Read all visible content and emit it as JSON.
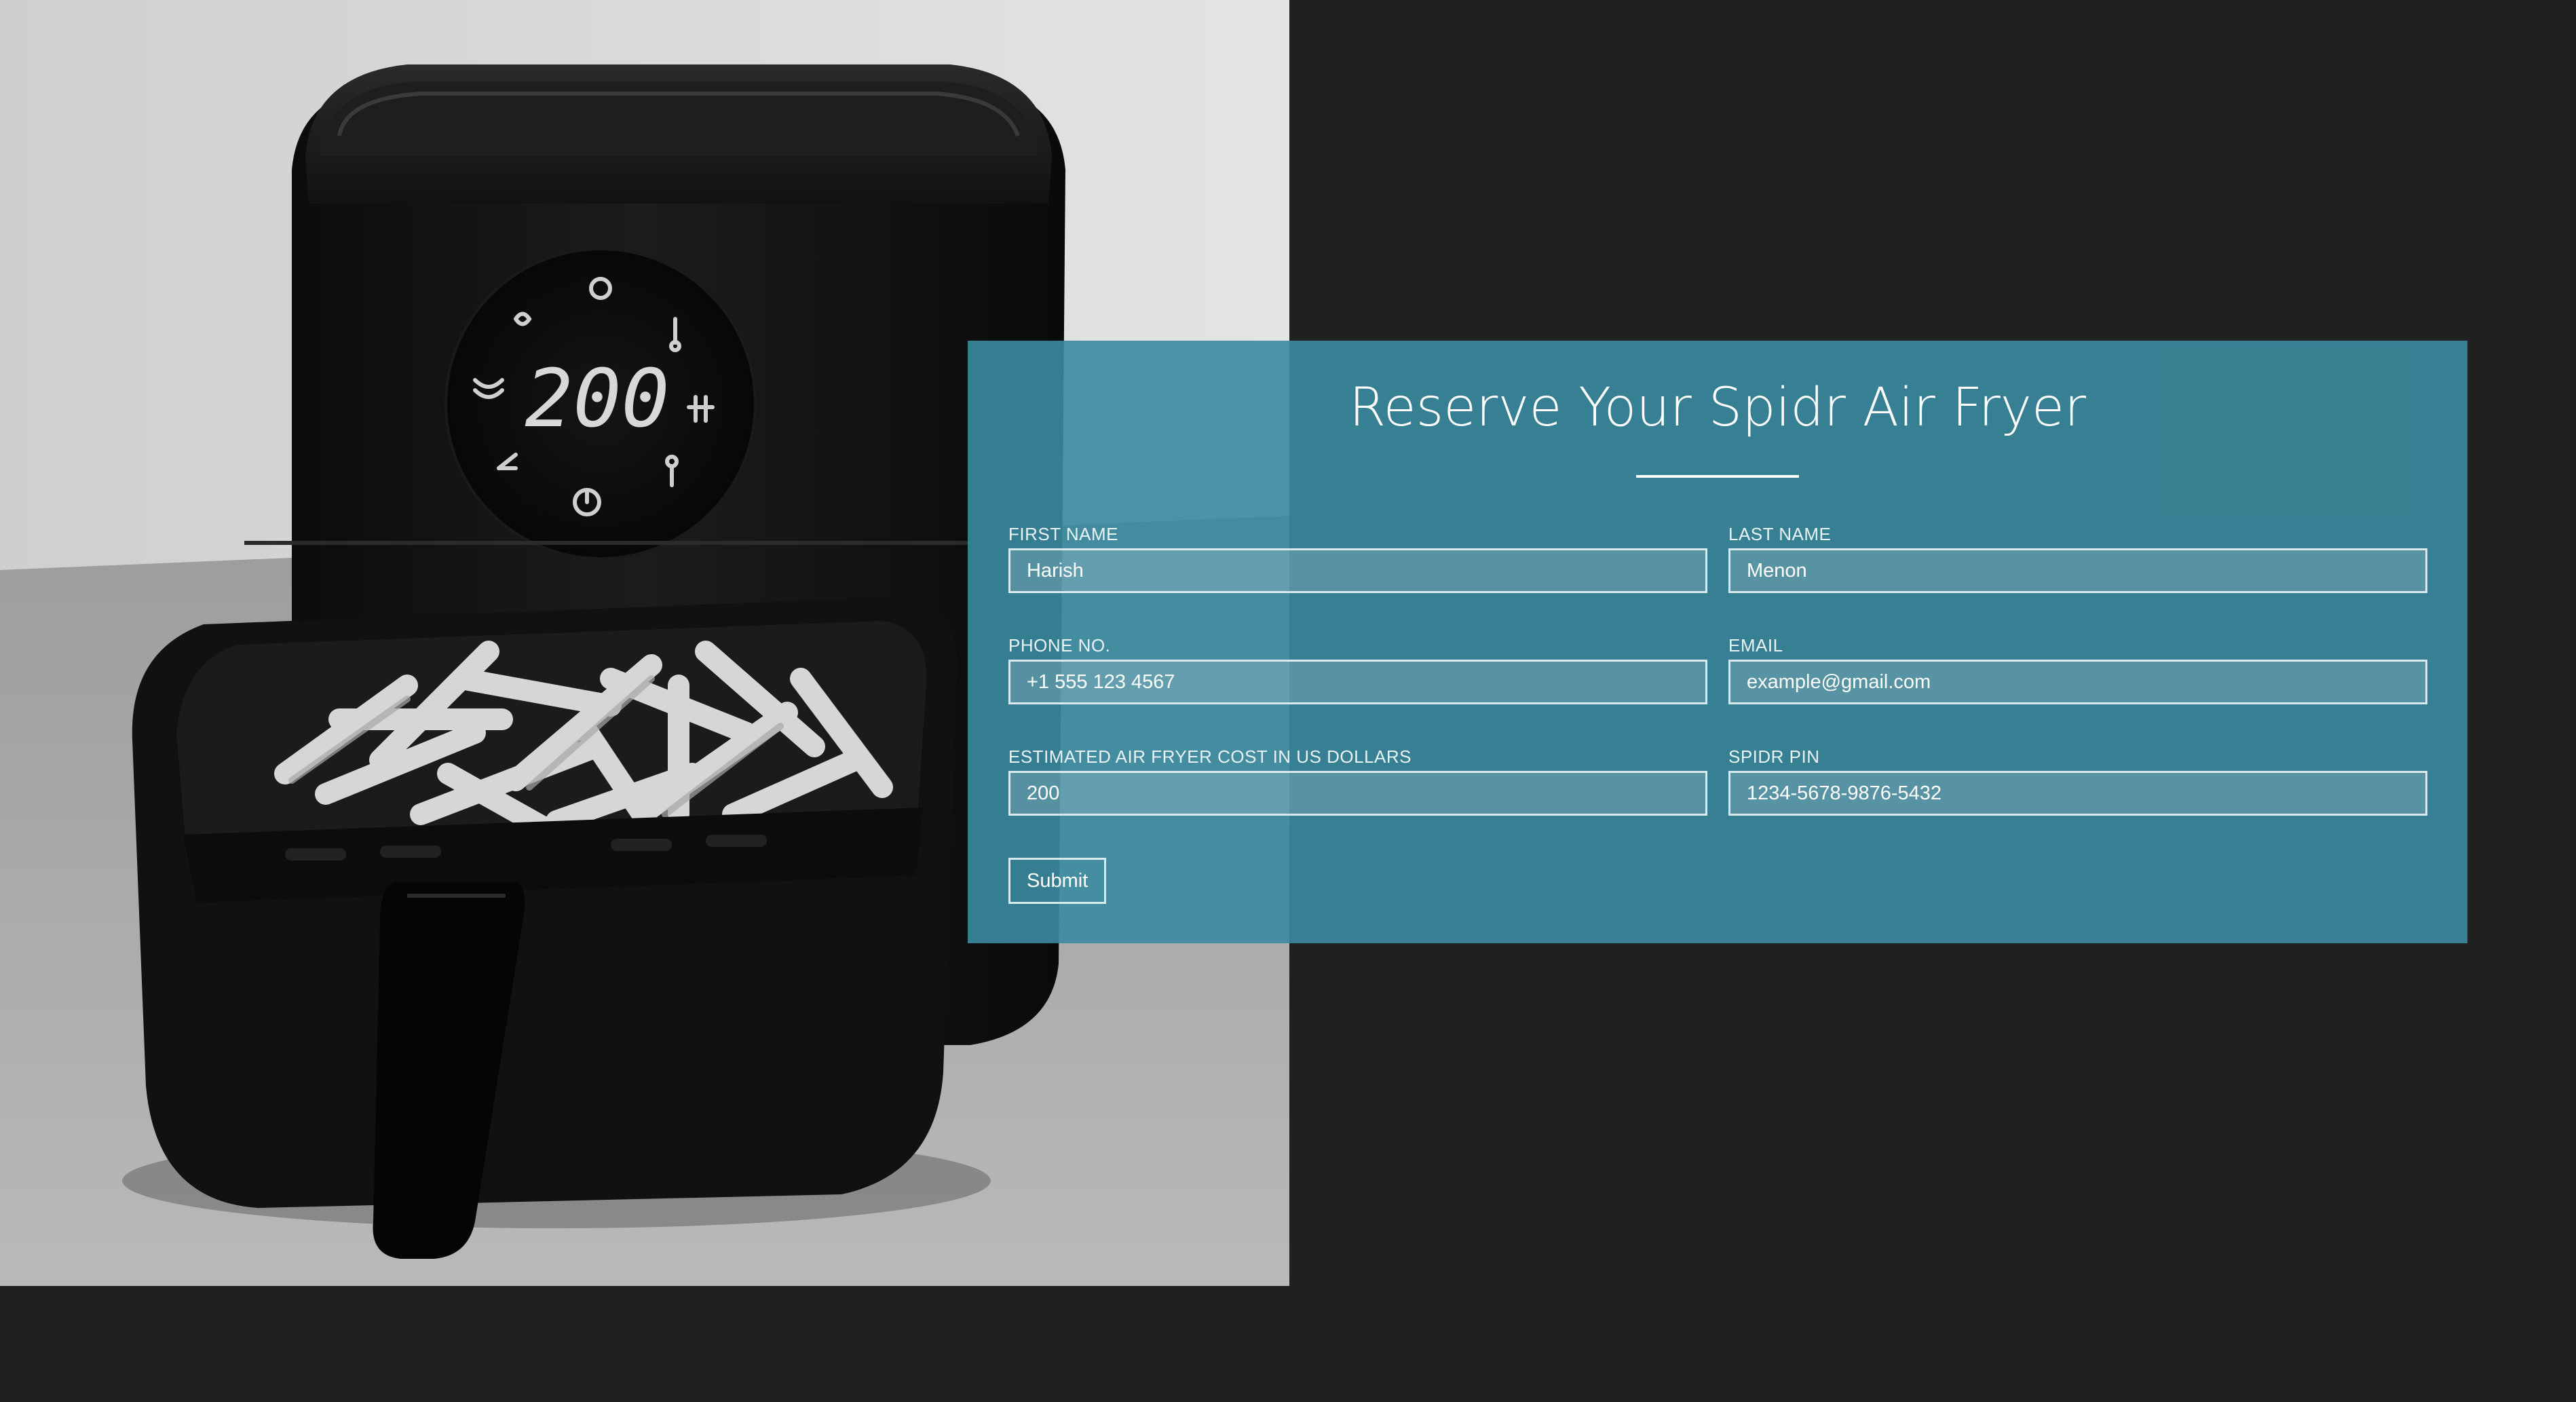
{
  "colors": {
    "page_background": "#202020",
    "form_panel": "#3a8a9e",
    "text": "#ffffff"
  },
  "form": {
    "title": "Reserve Your Spidr Air Fryer",
    "fields": {
      "first_name": {
        "label": "FIRST NAME",
        "value": "Harish"
      },
      "last_name": {
        "label": "LAST NAME",
        "value": "Menon"
      },
      "phone": {
        "label": "PHONE NO.",
        "value": "+1 555 123 4567"
      },
      "email": {
        "label": "EMAIL",
        "value": "example@gmail.com"
      },
      "cost": {
        "label": "ESTIMATED AIR FRYER COST IN US DOLLARS",
        "value": "200"
      },
      "pin": {
        "label": "SPIDR PIN",
        "value": "1234-5678-9876-5432"
      }
    },
    "submit_label": "Submit"
  },
  "product_display": {
    "readout": "200"
  }
}
